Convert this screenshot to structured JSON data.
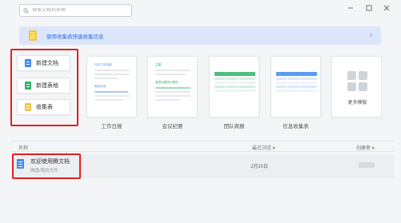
{
  "search": {
    "placeholder": "搜索文档和表格"
  },
  "window": {
    "buttons": [
      "minimize",
      "maximize",
      "close"
    ]
  },
  "banner": {
    "text": "使用收集表快速收集信息",
    "arrow": "›"
  },
  "create": [
    {
      "label": "新建文档",
      "icon": "doc-icon",
      "color": "#3b8bf0"
    },
    {
      "label": "新建表格",
      "icon": "sheet-icon",
      "color": "#2fb36b"
    },
    {
      "label": "收集表",
      "icon": "form-icon",
      "color": "#f2c744"
    }
  ],
  "templates": [
    {
      "label": "工作日报",
      "preview": [
        "今日工作总结",
        "明日计划"
      ]
    },
    {
      "label": "会议纪要",
      "preview": [
        "主题",
        "嘉宾议题执行情况"
      ]
    },
    {
      "label": "团队周报",
      "preview": []
    },
    {
      "label": "信息收集表",
      "preview": []
    },
    {
      "label": "更多模版",
      "preview": []
    }
  ],
  "list": {
    "col_name": "名称",
    "col_recent": "最近浏览 ▾",
    "col_creator": "创建者 ▾",
    "rows": [
      {
        "title": "欢迎使用腾文档",
        "path": "微盘/我的文件",
        "date": "2月20日"
      }
    ]
  },
  "colors": {
    "accent": "#2f6ddb",
    "highlight": "#e02020",
    "banner_bg": "#dce6fa"
  }
}
